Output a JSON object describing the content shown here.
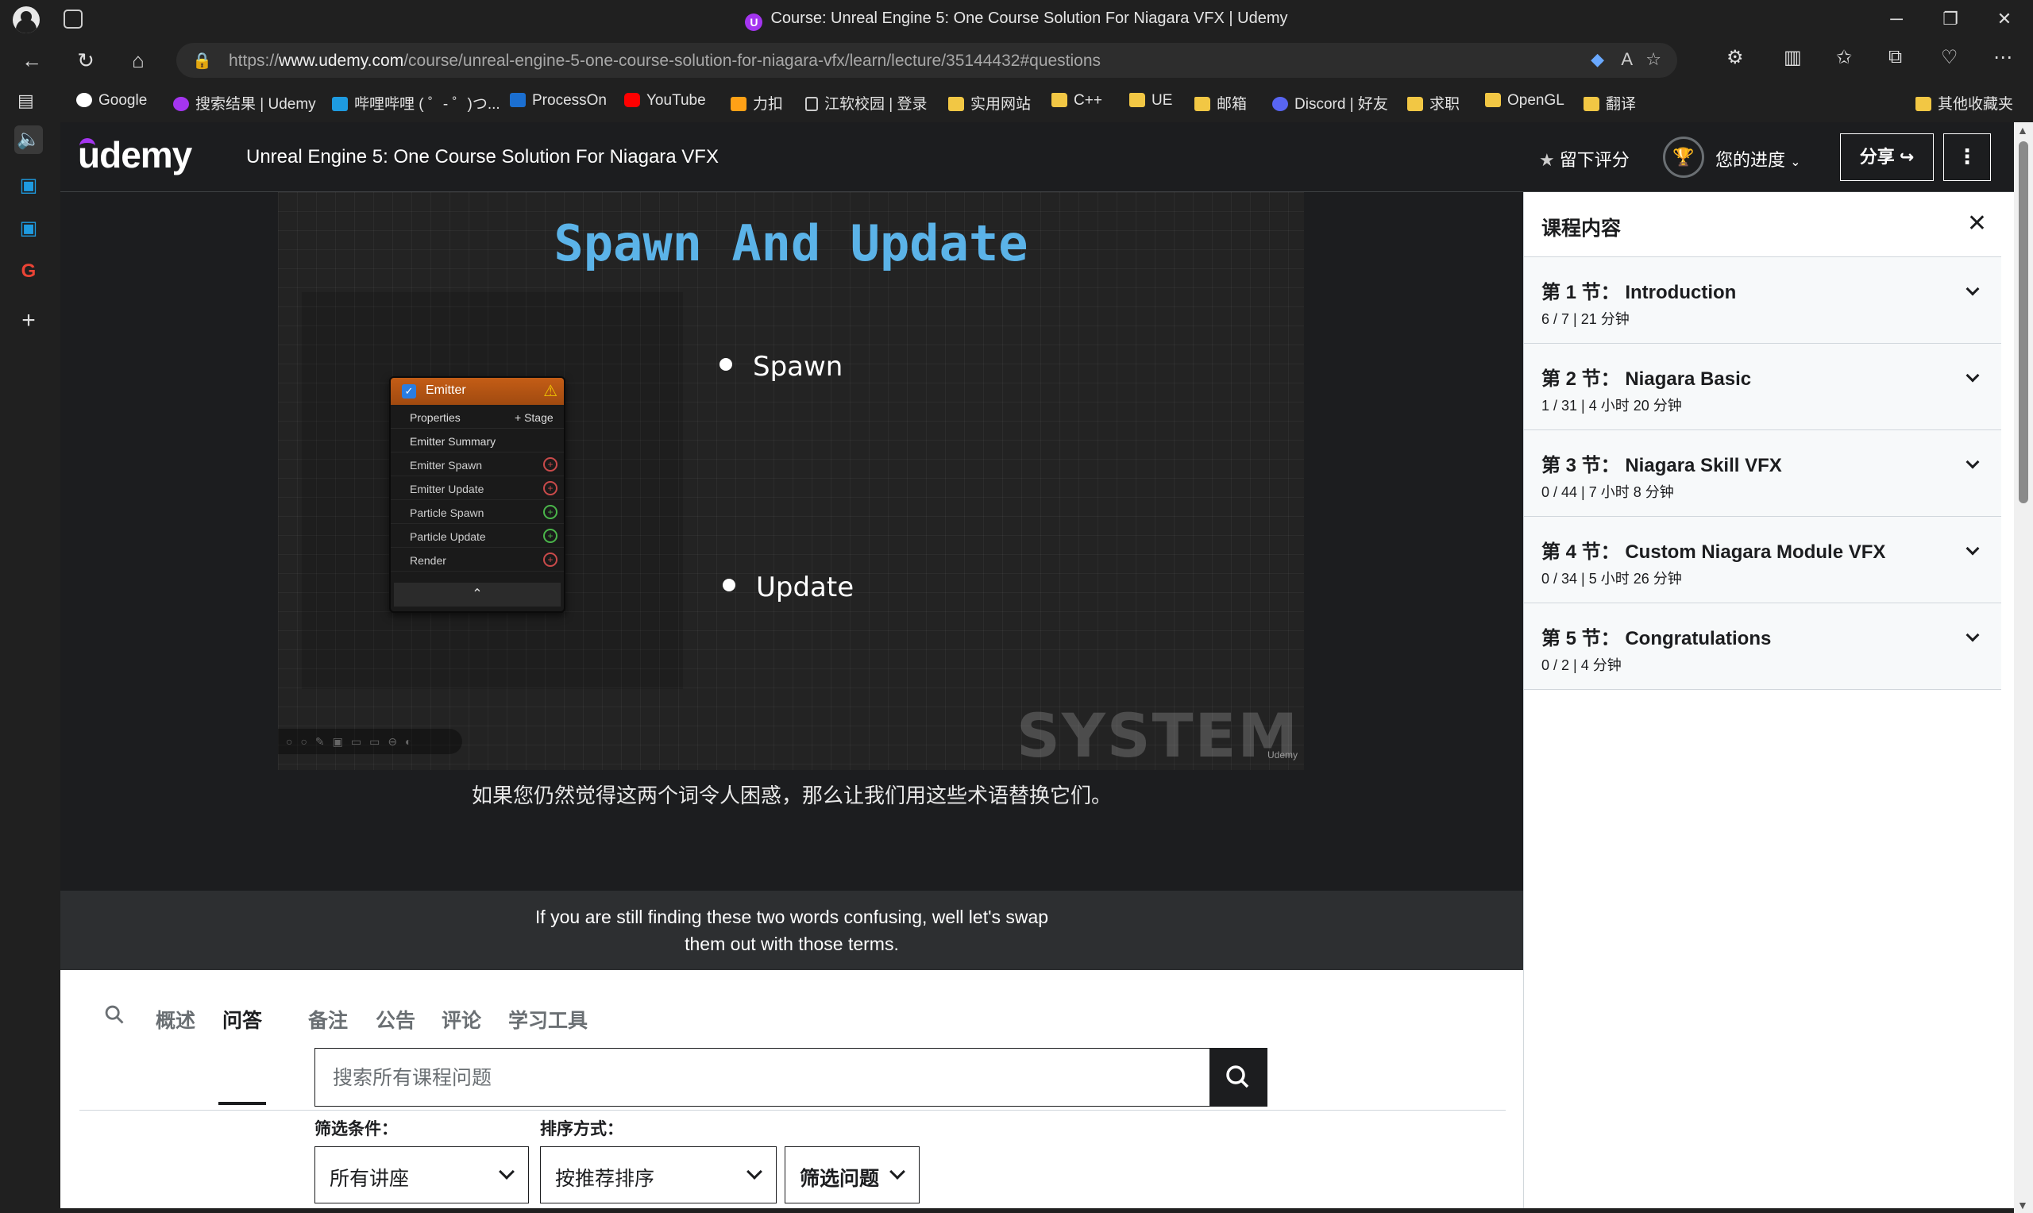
{
  "browser": {
    "window_title": "Course: Unreal Engine 5: One Course Solution For Niagara VFX | Udemy",
    "url_prefix": "https://",
    "url_domain": "www.udemy.com",
    "url_path": "/course/unreal-engine-5-one-course-solution-for-niagara-vfx/learn/lecture/35144432#questions",
    "bookmarks": [
      {
        "label": "Google",
        "icon": "google-icon"
      },
      {
        "label": "搜索结果 | Udemy",
        "icon": "udemy-icon"
      },
      {
        "label": "哔哩哔哩 ( ゜- ゜)つ...",
        "icon": "bilibili-icon"
      },
      {
        "label": "ProcessOn",
        "icon": "processon-icon"
      },
      {
        "label": "YouTube",
        "icon": "youtube-icon"
      },
      {
        "label": "力扣",
        "icon": "leetcode-icon"
      },
      {
        "label": "江软校园 | 登录",
        "icon": "document-icon"
      },
      {
        "label": "实用网站",
        "icon": "folder-icon"
      },
      {
        "label": "C++",
        "icon": "folder-icon"
      },
      {
        "label": "UE",
        "icon": "folder-icon"
      },
      {
        "label": "邮箱",
        "icon": "folder-icon"
      },
      {
        "label": "Discord | 好友",
        "icon": "discord-icon"
      },
      {
        "label": "求职",
        "icon": "folder-icon"
      },
      {
        "label": "OpenGL",
        "icon": "folder-icon"
      },
      {
        "label": "翻译",
        "icon": "folder-icon"
      },
      {
        "label": "其他收藏夹",
        "icon": "folder-icon"
      }
    ]
  },
  "header": {
    "logo": "udemy",
    "course_title": "Unreal Engine 5: One Course Solution For Niagara VFX",
    "rate_label": "留下评分",
    "progress_label": "您的进度",
    "share_label": "分享"
  },
  "video": {
    "slide_title": "Spawn And Update",
    "bullet_1": "Spawn",
    "bullet_2": "Update",
    "node": {
      "title": "Emitter",
      "properties": "Properties",
      "stage": "Stage",
      "summary": "Emitter Summary",
      "rows": [
        "Emitter Spawn",
        "Emitter Update",
        "Particle Spawn",
        "Particle Update",
        "Render"
      ]
    },
    "watermark": "SYSTEM",
    "watermark_small": "Udemy",
    "subtitle_cn": "如果您仍然觉得这两个词令人困惑，那么让我们用这些术语替换它们。",
    "caption_line_1": "If you are still finding these two words confusing, well let's swap",
    "caption_line_2": "them out with those terms."
  },
  "tabs": {
    "items": [
      "概述",
      "问答",
      "备注",
      "公告",
      "评论",
      "学习工具"
    ],
    "active": "问答"
  },
  "qa": {
    "search_placeholder": "搜索所有课程问题",
    "filter_label": "筛选条件：",
    "sort_label": "排序方式：",
    "filter_value": "所有讲座",
    "sort_value": "按推荐排序",
    "filter_questions": "筛选问题"
  },
  "sidebar": {
    "title": "课程内容",
    "sections": [
      {
        "title": "第 1 节：  Introduction",
        "meta": "6 / 7 | 21 分钟"
      },
      {
        "title": "第 2 节：  Niagara Basic",
        "meta": "1 / 31 | 4 小时 20 分钟"
      },
      {
        "title": "第 3 节：  Niagara Skill VFX",
        "meta": "0 / 44 | 7 小时 8 分钟"
      },
      {
        "title": "第 4 节：  Custom Niagara Module VFX",
        "meta": "0 / 34 | 5 小时 26 分钟"
      },
      {
        "title": "第 5 节：  Congratulations",
        "meta": "0 / 2 | 4 分钟"
      }
    ]
  },
  "colors": {
    "udemy_purple": "#a435f0",
    "header_dark": "#1c1d1f",
    "slide_title_blue": "#5bb3e8"
  }
}
